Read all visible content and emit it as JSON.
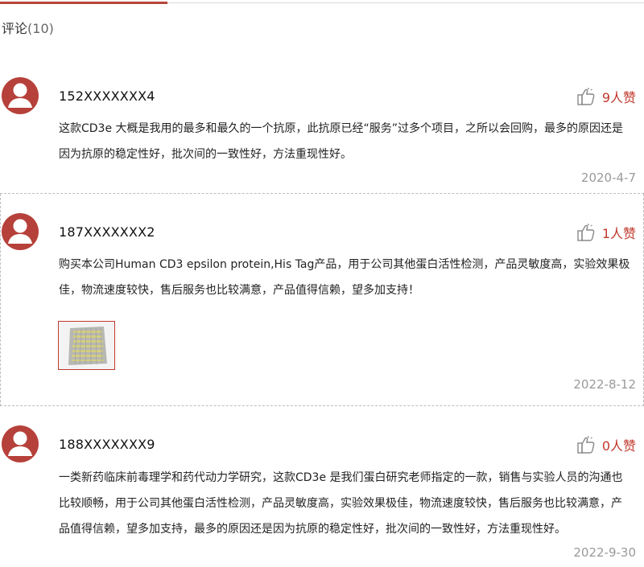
{
  "section": {
    "title": "评论",
    "count": "(10)"
  },
  "reviews": [
    {
      "username": "152XXXXXXX4",
      "likes": "9人赞",
      "comment": "这款CD3e 大概是我用的最多和最久的一个抗原，此抗原已经“服务”过多个项目，之所以会回购，最多的原因还是因为抗原的稳定性好，批次间的一致性好，方法重现性好。",
      "date": "2020-4-7"
    },
    {
      "username": "187XXXXXXX2",
      "likes": "1人赞",
      "comment": "购买本公司Human CD3 epsilon protein,His Tag产品，用于公司其他蛋白活性检测，产品灵敏度高，实验效果极佳，物流速度较快，售后服务也比较满意，产品值得信赖，望多加支持！",
      "date": "2022-8-12"
    },
    {
      "username": "188XXXXXXX9",
      "likes": "0人赞",
      "comment": "一类新药临床前毒理学和药代动力学研究，这款CD3e 是我们蛋白研究老师指定的一款，销售与实验人员的沟通也比较顺畅，用于公司其他蛋白活性检测，产品灵敏度高，实验效果极佳，物流速度较快，售后服务也比较满意，产品值得信赖，望多加支持，最多的原因还是因为抗原的稳定性好，批次间的一致性好，方法重现性好。",
      "date": "2022-9-30"
    }
  ],
  "colors": {
    "accent": "#b6413a",
    "like_red": "#c0392b",
    "date_gray": "#9a9a9a"
  },
  "icons": {
    "avatar": "user-silhouette-icon",
    "like": "thumbs-up-icon"
  }
}
